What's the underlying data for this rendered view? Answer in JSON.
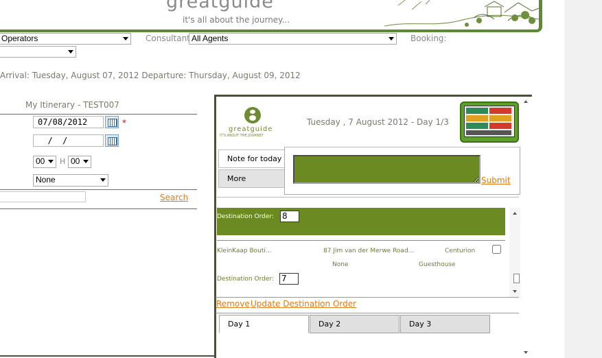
{
  "header": {
    "brand": "greatguide",
    "tagline": "it's all about the journey..."
  },
  "filters": {
    "operators_value": "Operators",
    "consultant_label": "Consultant:",
    "consultant_value": "All Agents",
    "booking_label": "Booking:",
    "second_select_value": ""
  },
  "trip": {
    "arrival_departure": "Arrival: Tuesday, August 07, 2012 Departure: Thursday, August 09, 2012"
  },
  "itinerary": {
    "title": "My Itinerary - TEST007",
    "date_value": "07/08/2012",
    "required_mark": "*",
    "date2_value": "  /  /",
    "hour_value": "00",
    "hour_sep": "H",
    "minute_value": "00",
    "type_value": "None",
    "search_placeholder": "",
    "search_label": "Search"
  },
  "day_panel": {
    "logo_word": "greatguide",
    "logo_sub": "IT'S ABOUT THE JOURNEY",
    "date_heading": "Tuesday , 7 August 2012 - Day 1/3",
    "tabs": [
      {
        "label": "Note for today"
      },
      {
        "label": "More"
      }
    ],
    "submit_label": "Submit",
    "dest_order_label_1": "Destination Order:",
    "dest_order_value_1": "8",
    "entry": {
      "name": "KleinKaap Bouti...",
      "address": "87 Jim van der Merwe Road...",
      "area": "Centurion",
      "meal": "None",
      "type": "Guesthouse"
    },
    "dest_order_label_2": "Destination Order:",
    "dest_order_value_2": "7",
    "remove_label": "Remove",
    "update_label": "Update Destination Order",
    "days": [
      {
        "label": "Day 1"
      },
      {
        "label": "Day 2"
      },
      {
        "label": "Day 3"
      }
    ]
  },
  "colors": {
    "accent_green": "#6b8a22",
    "link_orange": "#e07b17",
    "label_green": "#6a7d2e"
  }
}
